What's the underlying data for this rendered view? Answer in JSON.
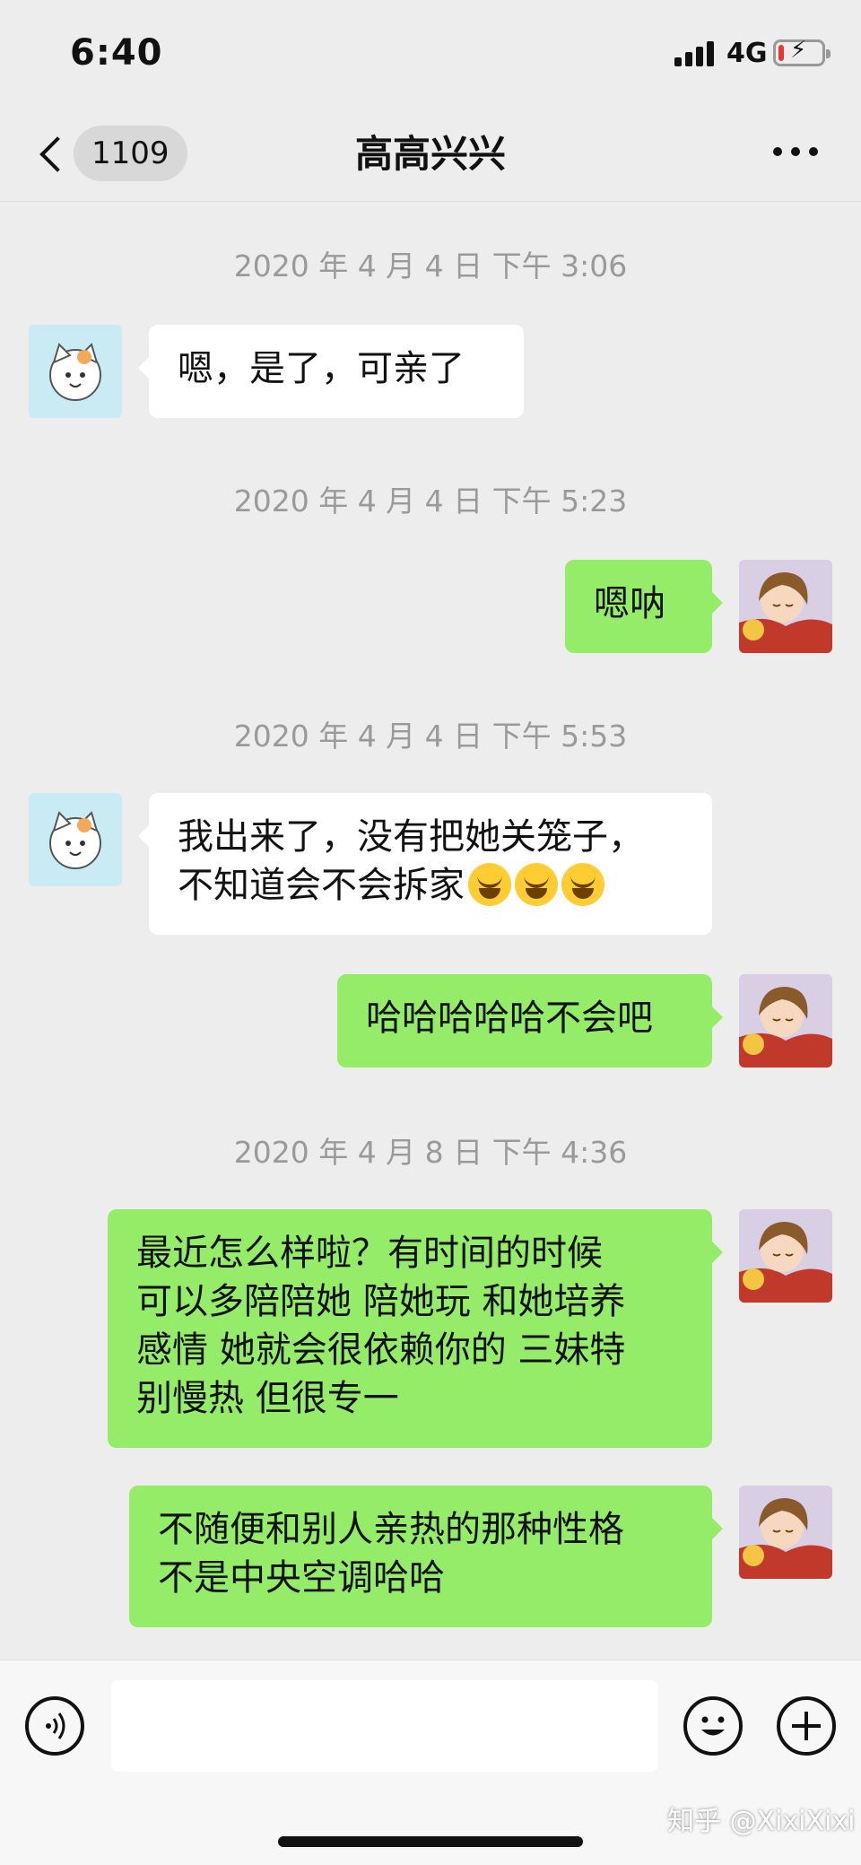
{
  "status_bar": {
    "time": "6:40",
    "network": "4G",
    "battery_level": 0.12,
    "battery_color": "#e53935"
  },
  "nav": {
    "unread_count": "1109",
    "title": "高高兴兴"
  },
  "messages": [
    {
      "type": "timestamp",
      "text": "2020 年 4 月 4 日  下午 3:06"
    },
    {
      "type": "incoming",
      "text": "嗯，是了，可亲了"
    },
    {
      "type": "timestamp",
      "text": "2020 年 4 月 4 日  下午 5:23"
    },
    {
      "type": "outgoing",
      "text": "嗯呐"
    },
    {
      "type": "timestamp",
      "text": "2020 年 4 月 4 日  下午 5:53"
    },
    {
      "type": "incoming",
      "line1": "我出来了，没有把她关笼子，",
      "line2": "不知道会不会拆家",
      "emoji": "laugh-cry-emoji"
    },
    {
      "type": "outgoing",
      "text": "哈哈哈哈哈不会吧"
    },
    {
      "type": "timestamp",
      "text": "2020 年 4 月 8 日  下午 4:36"
    },
    {
      "type": "outgoing",
      "lines": [
        "最近怎么样啦？有时间的时候",
        "可以多陪陪她 陪她玩 和她培养",
        "感情 她就会很依赖你的  三妹特",
        "别慢热 但很专一"
      ]
    },
    {
      "type": "outgoing",
      "lines": [
        "不随便和别人亲热的那种性格",
        "不是中央空调哈哈"
      ]
    }
  ],
  "colors": {
    "background": "#ededed",
    "outgoing_bubble": "#95ec69",
    "incoming_bubble": "#ffffff",
    "timestamp": "#9a9a9a"
  },
  "input_bar": {
    "value": "",
    "watermark": "知乎 @XixiXixi"
  },
  "icons": [
    "back-arrow-icon",
    "more-icon",
    "voice-icon",
    "emoji-icon",
    "plus-icon",
    "signal-icon",
    "battery-icon"
  ]
}
